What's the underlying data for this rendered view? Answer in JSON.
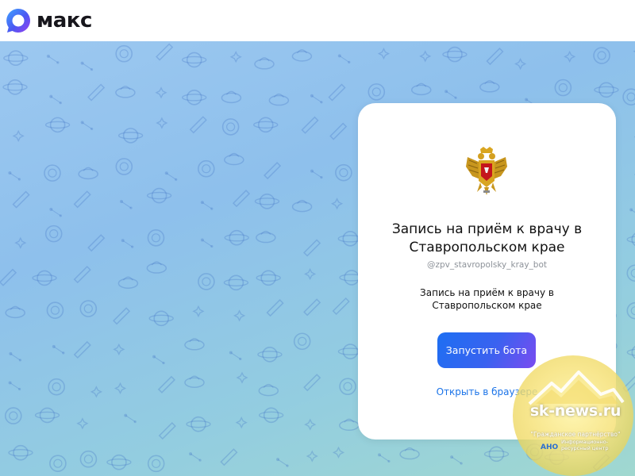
{
  "app": {
    "brand_name": "макс",
    "logo_icon": "max-logo-icon"
  },
  "bot": {
    "emblem_icon": "russian-coat-of-arms-icon",
    "title": "Запись на приём к врачу в Ставропольском крае",
    "handle": "@zpv_stavropolsky_kray_bot",
    "description": "Запись на приём к врачу в Ставропольском крае",
    "start_button_label": "Запустить бота",
    "open_in_browser_label": "Открыть в браузере"
  },
  "watermark": {
    "site": "sk-news.ru",
    "party": "\"Гражданское партнёрство\"",
    "ano": "АНО",
    "org": "Информационно-ресурсный центр"
  },
  "colors": {
    "accent": "#1a73e8",
    "button_gradient_start": "#1d6ff2",
    "button_gradient_end": "#7a4bf0",
    "background_top": "#9cc8f0",
    "background_bottom": "#a0d8d0"
  }
}
